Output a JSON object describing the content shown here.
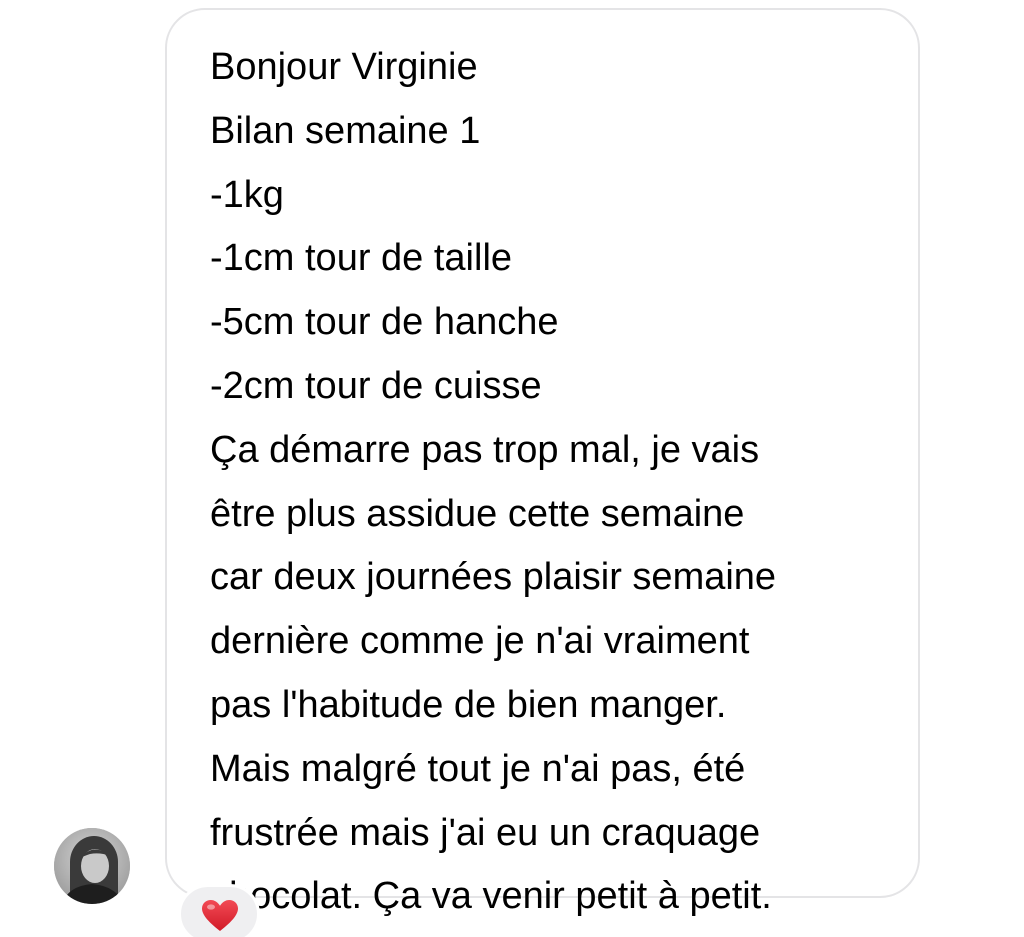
{
  "message": {
    "lines": [
      "Bonjour Virginie",
      "Bilan semaine 1",
      "-1kg",
      "-1cm tour de taille",
      "-5cm tour de hanche",
      "-2cm tour de cuisse",
      "Ça démarre pas trop mal, je vais",
      "être plus assidue cette semaine",
      "car deux journées plaisir semaine",
      "dernière comme je n'ai vraiment",
      "pas l'habitude de bien manger.",
      "Mais malgré tout je n'ai pas, été",
      "frustrée mais j'ai eu un craquage",
      "chocolat. Ça va venir petit à petit."
    ]
  },
  "reaction": {
    "icon": "heart-icon",
    "color": "#e0212f"
  },
  "colors": {
    "bubble_border": "#e4e4e6",
    "reaction_bg": "#efeff1",
    "text": "#000000"
  }
}
